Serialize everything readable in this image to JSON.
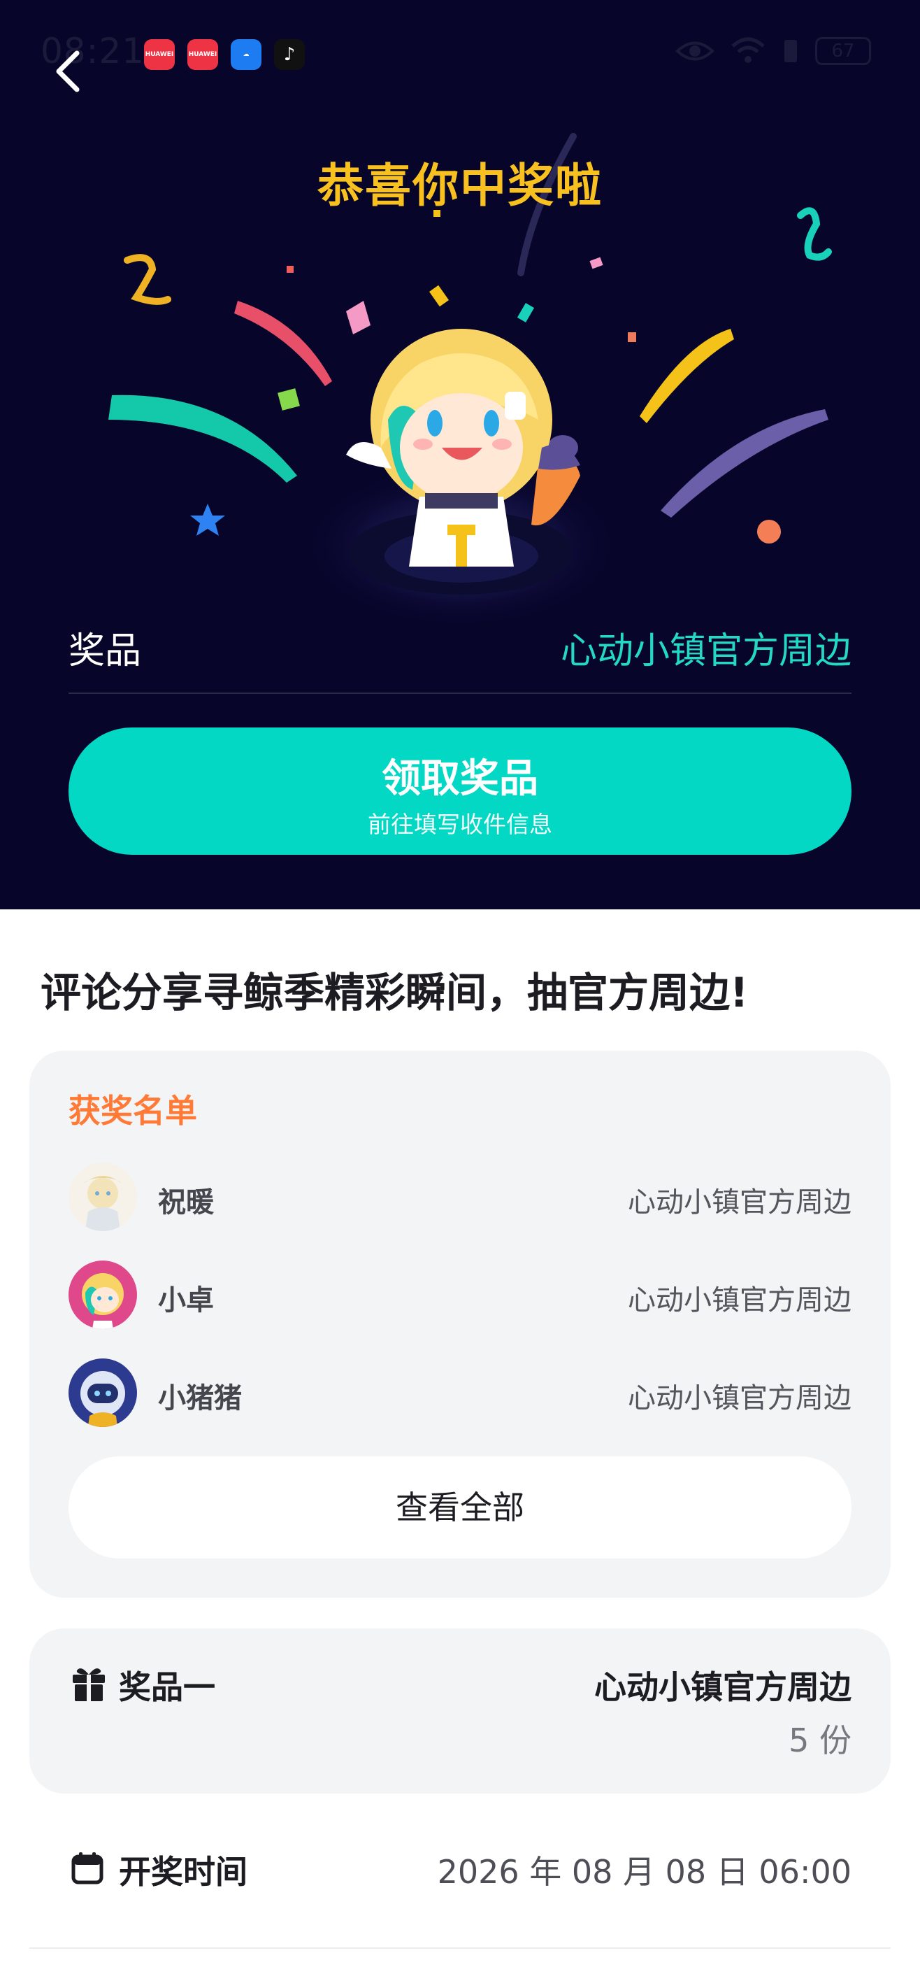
{
  "status_bar": {
    "time": "08:21",
    "app_icons": [
      {
        "name": "huawei-appgallery-icon",
        "label": "HUAWEI",
        "color": "#ee3344"
      },
      {
        "name": "huawei-appgallery-icon",
        "label": "HUAWEI",
        "color": "#ee3344"
      },
      {
        "name": "weather-app-icon",
        "label": "",
        "color": "#1e7cf2"
      },
      {
        "name": "tiktok-icon",
        "label": "",
        "color": "#111111"
      }
    ],
    "battery": "67"
  },
  "hero": {
    "title": "恭喜你中奖啦",
    "prize_label": "奖品",
    "prize_value": "心动小镇官方周边",
    "claim_button": "领取奖品",
    "claim_subtitle": "前往填写收件信息"
  },
  "headline": "评论分享寻鲸季精彩瞬间，抽官方周边!",
  "winners": {
    "title": "获奖名单",
    "list": [
      {
        "name": "祝暖",
        "prize": "心动小镇官方周边"
      },
      {
        "name": "小卓",
        "prize": "心动小镇官方周边"
      },
      {
        "name": "小猪猪",
        "prize": "心动小镇官方周边"
      }
    ],
    "view_all": "查看全部"
  },
  "prize_one": {
    "label": "奖品一",
    "name": "心动小镇官方周边",
    "count": "5 份"
  },
  "draw_time": {
    "label": "开奖时间",
    "value": "2026 年 08 月 08 日 06:00"
  },
  "colors": {
    "hero_bg": "#07052a",
    "accent_teal": "#03d8c5",
    "title_yellow": "#f9c11f",
    "winner_orange": "#ff7a37"
  }
}
